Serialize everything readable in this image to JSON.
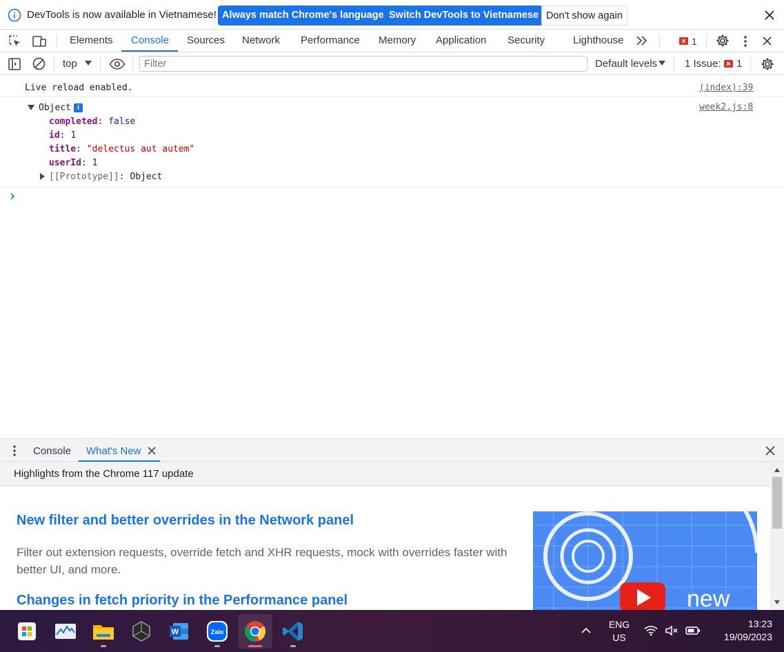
{
  "infobar": {
    "message": "DevTools is now available in Vietnamese!",
    "btn_match": "Always match Chrome's language",
    "btn_switch": "Switch DevTools to Vietnamese",
    "btn_dismiss": "Don't show again"
  },
  "main_tabs": [
    "Elements",
    "Console",
    "Sources",
    "Network",
    "Performance",
    "Memory",
    "Application",
    "Security",
    "Lighthouse"
  ],
  "active_tab": "Console",
  "error_count": "1",
  "toolbar": {
    "context": "top",
    "filter_placeholder": "Filter",
    "levels": "Default levels",
    "issues_label": "1 Issue:",
    "issues_count": "1"
  },
  "console": {
    "live_reload": "Live reload enabled.",
    "live_reload_src": "(index):39",
    "object_label": "Object",
    "object_src": "week2.js:8",
    "props": {
      "completed_key": "completed",
      "completed_val": "false",
      "id_key": "id",
      "id_val": "1",
      "title_key": "title",
      "title_val": "\"delectus aut autem\"",
      "userId_key": "userId",
      "userId_val": "1",
      "proto_key": "[[Prototype]]",
      "proto_val": "Object"
    },
    "prompt": ">"
  },
  "drawer": {
    "tabs": [
      "Console",
      "What's New"
    ],
    "active_tab": "What's New",
    "header": "Highlights from the Chrome 117 update",
    "heading1": "New filter and better overrides in the Network panel",
    "desc1": "Filter out extension requests, override fetch and XHR requests, mock with overrides faster with better UI, and more.",
    "heading2": "Changes in fetch priority in the Performance panel",
    "image_text": "new"
  },
  "taskbar": {
    "lang_top": "ENG",
    "lang_bottom": "US",
    "time": "13:23",
    "date": "19/09/2023"
  },
  "colors": {
    "accent": "#1a73e8",
    "error": "#d93025",
    "taskbar": "#3b1a3d"
  }
}
